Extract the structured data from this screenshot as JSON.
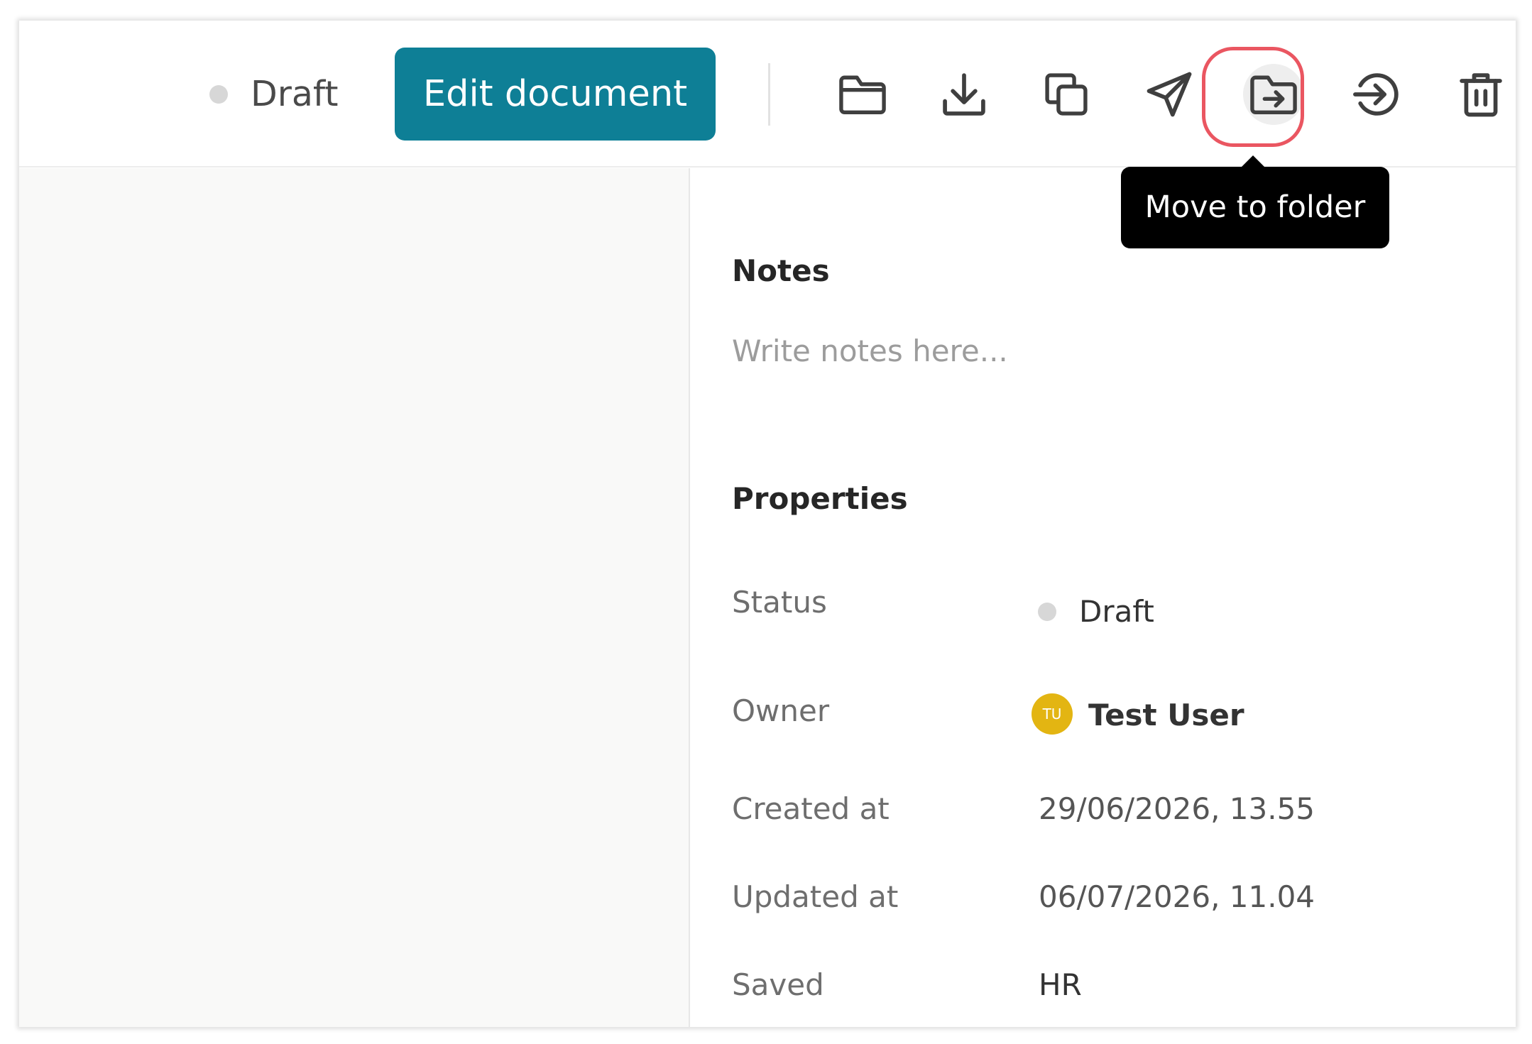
{
  "toolbar": {
    "status_label": "Draft",
    "edit_button_label": "Edit document",
    "icons": [
      "folder-icon",
      "download-icon",
      "copy-icon",
      "send-icon",
      "move-to-folder-icon",
      "sign-in-icon",
      "trash-icon"
    ],
    "tooltip": "Move to folder"
  },
  "notes": {
    "heading": "Notes",
    "placeholder": "Write notes here..."
  },
  "properties": {
    "heading": "Properties",
    "status": {
      "label": "Status",
      "value": "Draft"
    },
    "owner": {
      "label": "Owner",
      "initials": "TU",
      "value": "Test User"
    },
    "created_at": {
      "label": "Created at",
      "value": "29/06/2026, 13.55"
    },
    "updated_at": {
      "label": "Updated at",
      "value": "06/07/2026, 11.04"
    },
    "saved": {
      "label": "Saved",
      "value": "HR"
    }
  },
  "colors": {
    "accent": "#0e7f96",
    "highlight": "#ea5661",
    "avatar": "#e3b512",
    "status_dot": "#d7d7d7"
  }
}
